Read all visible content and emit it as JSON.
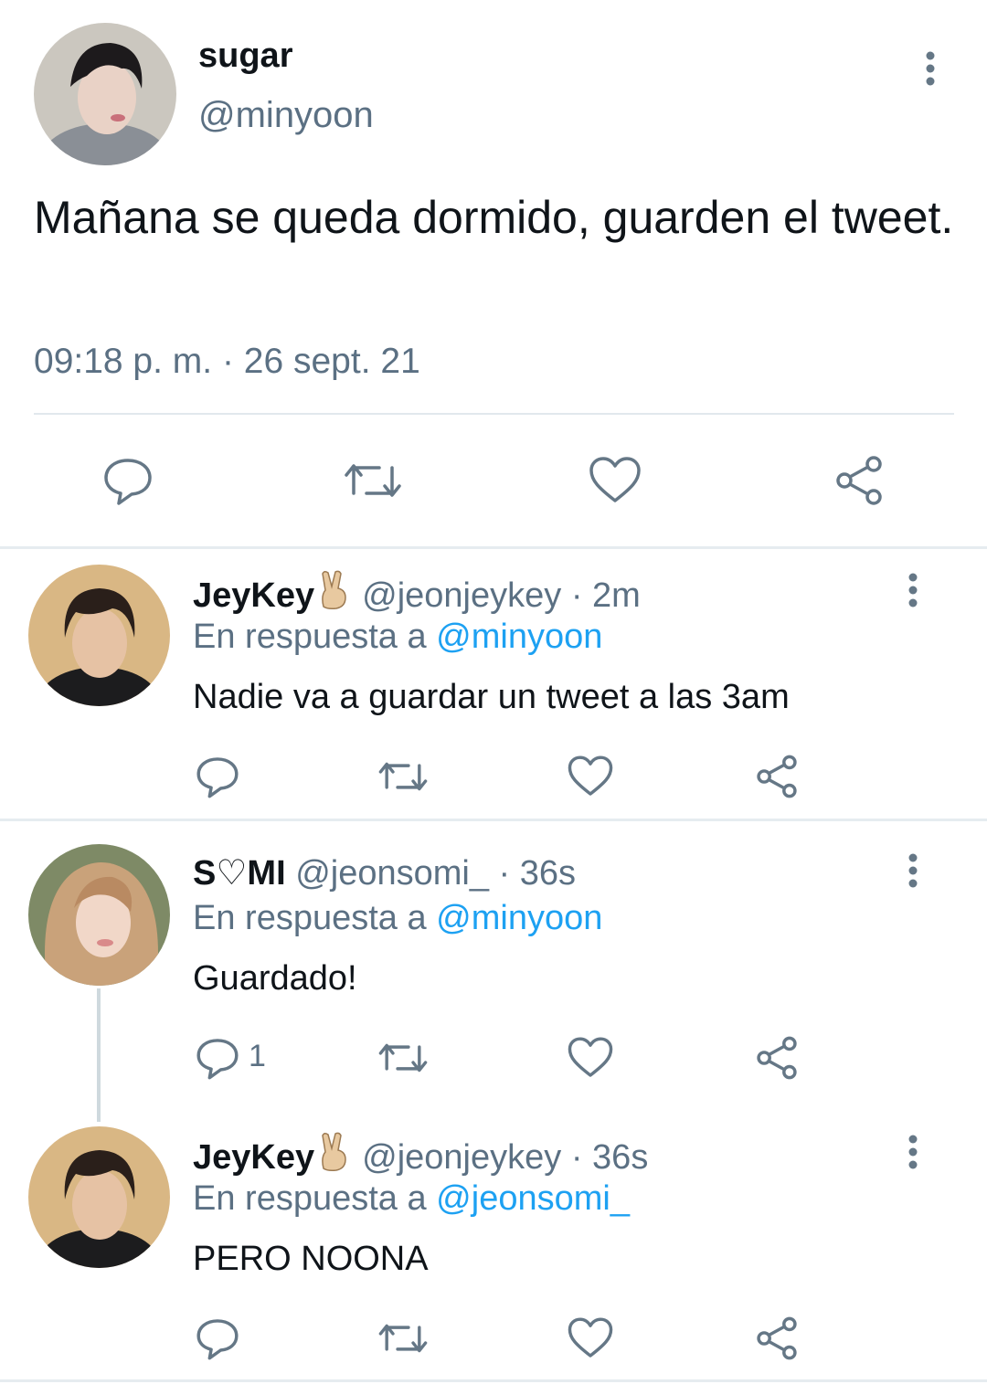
{
  "main_tweet": {
    "name": "sugar",
    "handle": "@minyoon",
    "text": "Mañana se queda dormido, guarden el tweet.",
    "timestamp": "09:18 p. m. · 26 sept. 21",
    "actions": [
      "reply-icon",
      "retweet-icon",
      "like-icon",
      "share-icon"
    ]
  },
  "replies": [
    {
      "name": "JeyKey",
      "emoji": "victory-hand-emoji",
      "handle": "@jeonjeykey",
      "separator": "·",
      "time": "2m",
      "in_reply_prefix": "En respuesta a",
      "in_reply_to": "@minyoon",
      "text": "Nadie va a guardar un tweet a las 3am",
      "reply_count": ""
    },
    {
      "name": "S♡MI",
      "emoji": "",
      "handle": "@jeonsomi_",
      "separator": "·",
      "time": "36s",
      "in_reply_prefix": "En respuesta a",
      "in_reply_to": "@minyoon",
      "text": "Guardado!",
      "reply_count": "1"
    },
    {
      "name": "JeyKey",
      "emoji": "victory-hand-emoji",
      "handle": "@jeonjeykey",
      "separator": "·",
      "time": "36s",
      "in_reply_prefix": "En respuesta a",
      "in_reply_to": "@jeonsomi_",
      "text": "PERO NOONA",
      "reply_count": ""
    }
  ],
  "colors": {
    "text": "#0f1419",
    "secondary": "#5b7083",
    "link": "#1da1f2",
    "divider": "#e6ecf0",
    "icon": "#657786"
  }
}
